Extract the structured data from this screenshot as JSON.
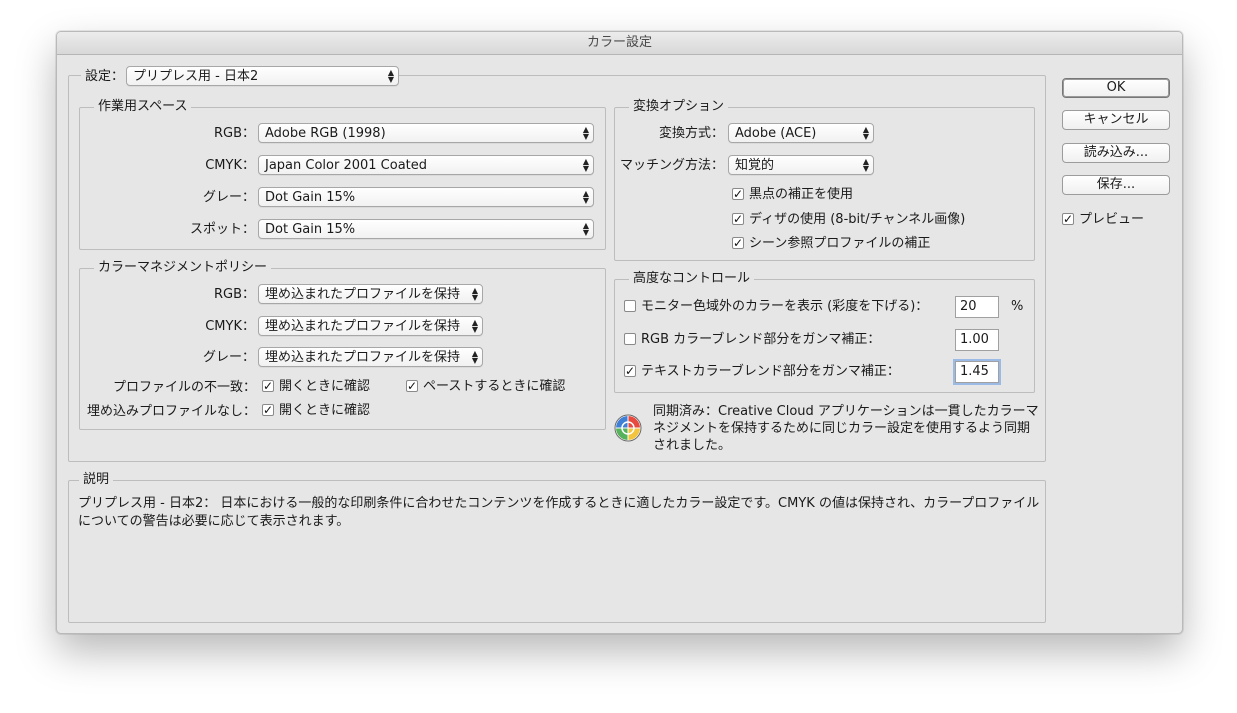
{
  "window": {
    "title": "カラー設定"
  },
  "settings": {
    "label": "設定：",
    "value": "プリプレス用 - 日本2"
  },
  "working_spaces": {
    "title": "作業用スペース",
    "rows": [
      {
        "label": "RGB：",
        "value": "Adobe RGB (1998)"
      },
      {
        "label": "CMYK：",
        "value": "Japan Color 2001 Coated"
      },
      {
        "label": "グレー：",
        "value": "Dot Gain 15%"
      },
      {
        "label": "スポット：",
        "value": "Dot Gain 15%"
      }
    ]
  },
  "policies": {
    "title": "カラーマネジメントポリシー",
    "rows": [
      {
        "label": "RGB：",
        "value": "埋め込まれたプロファイルを保持"
      },
      {
        "label": "CMYK：",
        "value": "埋め込まれたプロファイルを保持"
      },
      {
        "label": "グレー：",
        "value": "埋め込まれたプロファイルを保持"
      }
    ],
    "mismatch_label": "プロファイルの不一致：",
    "mismatch_open": {
      "label": "開くときに確認",
      "checked": true
    },
    "mismatch_paste": {
      "label": "ペーストするときに確認",
      "checked": true
    },
    "missing_label": "埋め込みプロファイルなし：",
    "missing_open": {
      "label": "開くときに確認",
      "checked": true
    }
  },
  "conversion": {
    "title": "変換オプション",
    "engine_label": "変換方式：",
    "engine_value": "Adobe (ACE)",
    "intent_label": "マッチング方法：",
    "intent_value": "知覚的",
    "options": [
      {
        "label": "黒点の補正を使用",
        "checked": true
      },
      {
        "label": "ディザの使用 (8-bit/チャンネル画像)",
        "checked": true
      },
      {
        "label": "シーン参照プロファイルの補正",
        "checked": true
      }
    ]
  },
  "advanced": {
    "title": "高度なコントロール",
    "rows": [
      {
        "label": "モニター色域外のカラーを表示 (彩度を下げる)：",
        "value": "20",
        "unit": "%",
        "checked": false
      },
      {
        "label": "RGB カラーブレンド部分をガンマ補正：",
        "value": "1.00",
        "unit": "",
        "checked": false
      },
      {
        "label": "テキストカラーブレンド部分をガンマ補正：",
        "value": "1.45",
        "unit": "",
        "checked": true
      }
    ]
  },
  "sync": {
    "icon": "color-wheel-icon",
    "lines": [
      "同期済み：Creative Cloud アプリケーションは一貫したカラーマ",
      "ネジメントを保持するために同じカラー設定を使用するよう同期",
      "されました。"
    ]
  },
  "description": {
    "title": "説明",
    "lines": [
      "プリプレス用 - 日本2： 日本における一般的な印刷条件に合わせたコンテンツを作成するときに適したカラー設定です。CMYK の値は保持され、カラープロファイル",
      "についての警告は必要に応じて表示されます。"
    ]
  },
  "buttons": {
    "ok": "OK",
    "cancel": "キャンセル",
    "load": "読み込み...",
    "save": "保存..."
  },
  "preview": {
    "label": "プレビュー",
    "checked": true
  }
}
